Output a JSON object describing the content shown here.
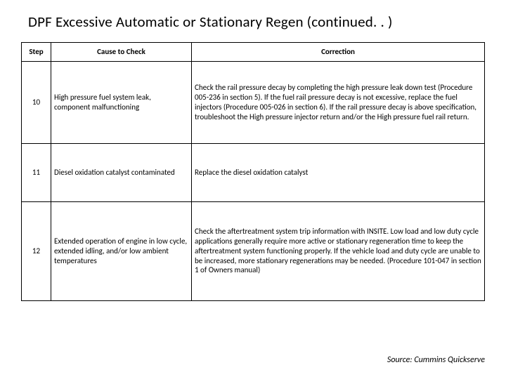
{
  "title": "DPF Excessive Automatic or Stationary Regen (continued. . )",
  "headers": {
    "step": "Step",
    "cause": "Cause to Check",
    "correction": "Correction"
  },
  "rows": [
    {
      "step": "10",
      "cause": "High pressure fuel system leak, component malfunctioning",
      "correction": "Check the rail pressure decay by completing the high pressure leak down test (Procedure 005-236 in section 5). If the fuel rail pressure decay is not excessive, replace the fuel injectors (Procedure 005-026 in section 6). If the rail pressure decay is above specification, troubleshoot the High pressure injector return and/or the High pressure fuel rail return."
    },
    {
      "step": "11",
      "cause": "Diesel oxidation catalyst contaminated",
      "correction": "Replace the diesel oxidation catalyst"
    },
    {
      "step": "12",
      "cause": "Extended operation of engine in low cycle, extended idling, and/or low ambient temperatures",
      "correction": "Check the aftertreatment system trip information with INSITE. Low load and low duty cycle applications generally require more active or stationary regeneration time to keep the aftertreatment system functioning properly. If the vehicle load and duty cycle are unable to be increased, more stationary regenerations may be needed. (Procedure 101-047 in section 1 of Owners manual)"
    }
  ],
  "source": "Source: Cummins Quickserve"
}
